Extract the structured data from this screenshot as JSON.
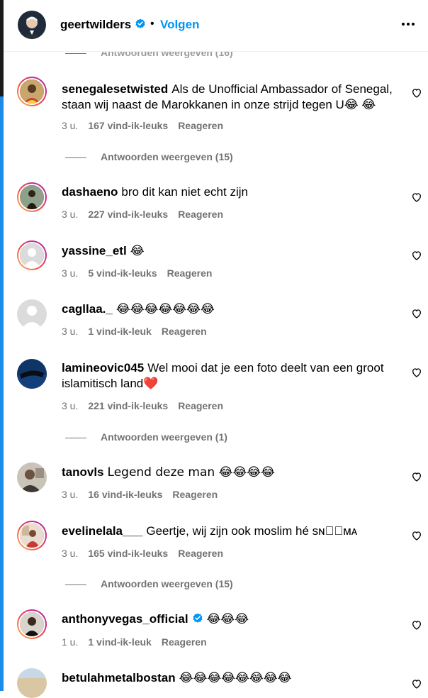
{
  "header": {
    "username": "geertwilders",
    "separator": "•",
    "follow_label": "Volgen"
  },
  "top_replies": {
    "label": "Antwoorden weergeven (16)"
  },
  "comments": [
    {
      "username": "senegalesetwisted",
      "text": "Als de Unofficial Ambassador of Senegal, staan wij naast de Marokkanen in onze strijd tegen U😂 😂",
      "time": "3 u.",
      "likes": "167 vind-ik-leuks",
      "reply": "Reageren",
      "replies": "Antwoorden weergeven (15)"
    },
    {
      "username": "dashaeno",
      "text": "bro dit kan niet echt zijn",
      "time": "3 u.",
      "likes": "227 vind-ik-leuks",
      "reply": "Reageren"
    },
    {
      "username": "yassine_etl",
      "text": "😂",
      "time": "3 u.",
      "likes": "5 vind-ik-leuks",
      "reply": "Reageren"
    },
    {
      "username": "cagllaa._",
      "text": "😂😂😂😂😂😂😂",
      "time": "3 u.",
      "likes": "1 vind-ik-leuk",
      "reply": "Reageren"
    },
    {
      "username": "lamineovic045",
      "text": "Wel mooi dat je een foto deelt van een groot islamitisch land❤️",
      "time": "3 u.",
      "likes": "221 vind-ik-leuks",
      "reply": "Reageren",
      "replies": "Antwoorden weergeven (1)"
    },
    {
      "username": "tanovls",
      "text": "Legend deze man 😂😂😂😂",
      "time": "3 u.",
      "likes": "16 vind-ik-leuks",
      "reply": "Reageren"
    },
    {
      "username": "evelinelala___",
      "text": "Geertje, wij zijn ook moslim hé sɴ⃞⃞ᴍᴀ",
      "time": "3 u.",
      "likes": "165 vind-ik-leuks",
      "reply": "Reageren",
      "replies": "Antwoorden weergeven (15)"
    },
    {
      "username": "anthonyvegas_official",
      "text": "😂😂😂",
      "time": "1 u.",
      "likes": "1 vind-ik-leuk",
      "reply": "Reageren"
    },
    {
      "username": "betulahmetalbostan",
      "text": "😂😂😂😂😂😂😂😂"
    }
  ],
  "colors": {
    "link_blue": "#0095f6",
    "meta_gray": "#737373",
    "story_ring": "#d62976",
    "verified_blue": "#0095f6"
  },
  "icons": {
    "header_avatar": "profile-photo",
    "verified": "verified-badge-icon",
    "more": "more-options-icon",
    "like": "heart-icon"
  }
}
